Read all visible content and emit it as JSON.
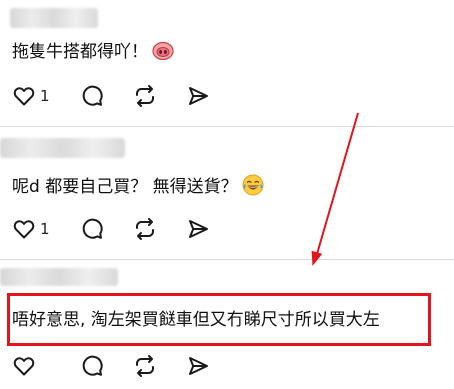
{
  "comments": [
    {
      "text": "拖隻牛搭都得吖！",
      "emoji": "pig-nose-emoji",
      "like_count": "1"
    },
    {
      "text": "呢d 都要自己買？ 無得送貨？",
      "emoji": "laughing-tears-emoji",
      "like_count": "1"
    },
    {
      "text": "唔好意思, 淘左架買餸車但又冇睇尺寸所以買大左",
      "like_count": ""
    }
  ],
  "icons": {
    "like": "heart-icon",
    "comment": "comment-bubble-icon",
    "repost": "repost-icon",
    "share": "send-icon"
  },
  "colors": {
    "annotation_red": "#e3141c",
    "divider": "#d9d9d9",
    "icon": "#1a1a1a"
  }
}
